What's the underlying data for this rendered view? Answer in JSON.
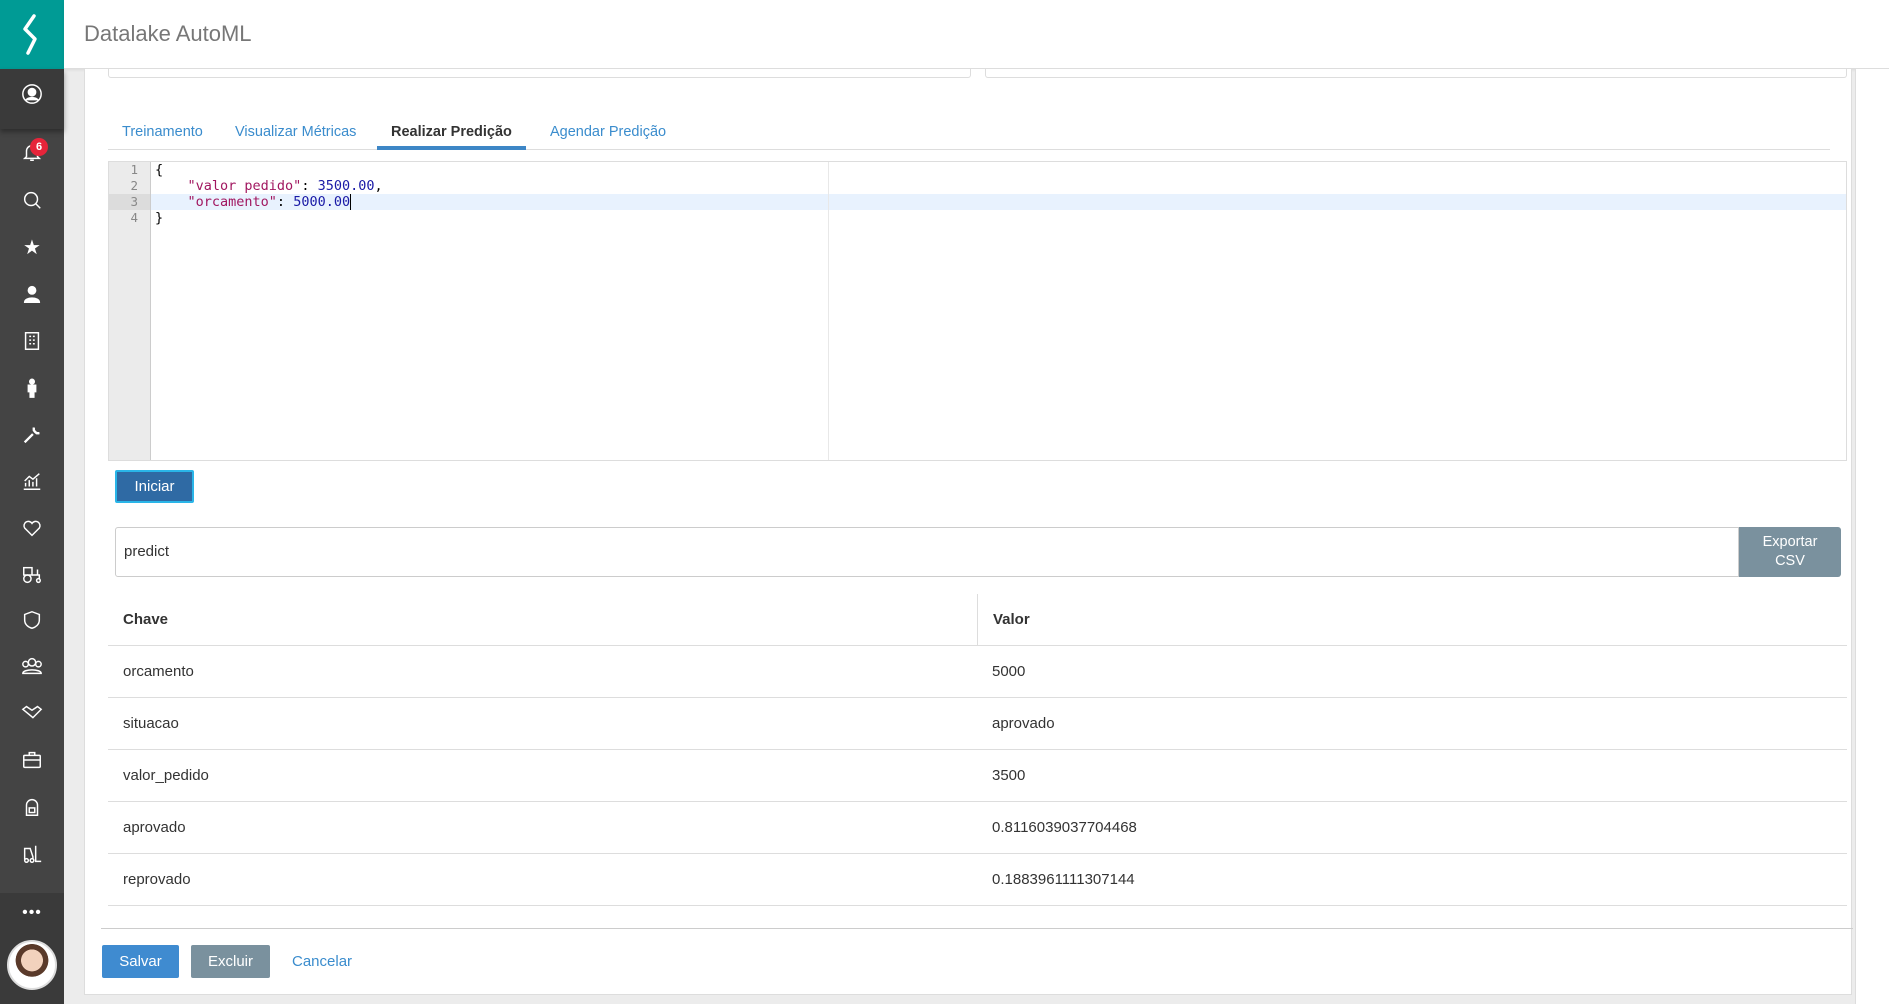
{
  "app": {
    "title": "Datalake AutoML"
  },
  "sidebar": {
    "notification_count": "6",
    "items": [
      "profile",
      "notifications",
      "search",
      "favorites",
      "user",
      "building",
      "person",
      "tools",
      "chart",
      "health",
      "tractor",
      "shield",
      "team",
      "handshake",
      "briefcase",
      "backpack",
      "forklift",
      "more"
    ]
  },
  "tabs": [
    {
      "label": "Treinamento"
    },
    {
      "label": "Visualizar Métricas"
    },
    {
      "label": "Realizar Predição",
      "active": true
    },
    {
      "label": "Agendar Predição"
    }
  ],
  "editor": {
    "lines": [
      "1",
      "2",
      "3",
      "4"
    ],
    "open": "{",
    "k1": "\"valor pedido\"",
    "v1": "3500.00",
    "k2": "\"orcamento\"",
    "v2": "5000.00",
    "close": "}"
  },
  "actions": {
    "start_label": "Iniciar",
    "export_label_1": "Exportar",
    "export_label_2": "CSV"
  },
  "result": {
    "model_name": "predict"
  },
  "table": {
    "headers": [
      "Chave",
      "Valor"
    ],
    "rows": [
      [
        "orcamento",
        "5000"
      ],
      [
        "situacao",
        "aprovado"
      ],
      [
        "valor_pedido",
        "3500"
      ],
      [
        "aprovado",
        "0.8116039037704468"
      ],
      [
        "reprovado",
        "0.1883961111307144"
      ]
    ]
  },
  "footer": {
    "save": "Salvar",
    "delete": "Excluir",
    "cancel": "Cancelar"
  },
  "colors": {
    "brand": "#009b95",
    "primary": "#3f8bd0",
    "secondary": "#7a919e",
    "badge": "#e6243a"
  }
}
